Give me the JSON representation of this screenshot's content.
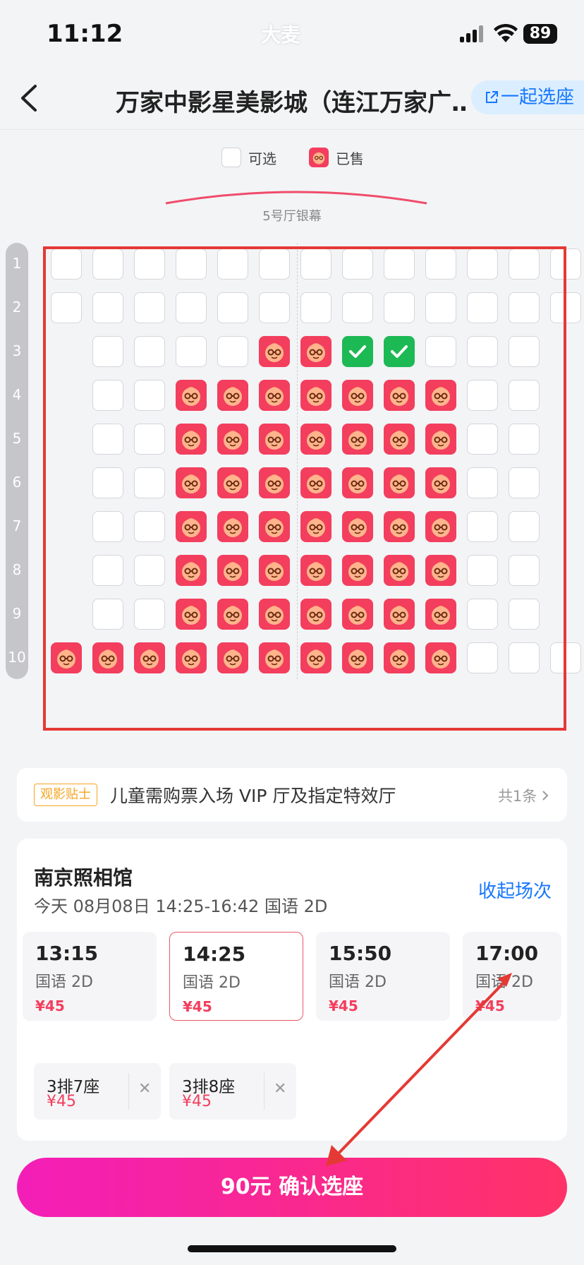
{
  "status_bar": {
    "time": "11:12",
    "brand": "大麦",
    "battery": "89"
  },
  "header": {
    "title": "万家中影星美影城（连江万家广…",
    "together_label": "一起选座"
  },
  "legend": {
    "available": "可选",
    "sold": "已售"
  },
  "screen": {
    "label": "5号厅银幕"
  },
  "seat_map": {
    "row_labels": [
      "1",
      "2",
      "3",
      "4",
      "5",
      "6",
      "7",
      "8",
      "9",
      "10"
    ],
    "rows": [
      "AAAAAAAAAAAAA",
      "AAAAAAAAAAAAA",
      "_AAAASSCCAAA_",
      "_AASSSSSSSAA_",
      "_AASSSSSSSAA_",
      "_AASSSSSSSAA_",
      "_AASSSSSSSAA_",
      "_AASSSSSSSAA_",
      "_AASSSSSSSAA_",
      "SSSSSSSSSSAAA"
    ]
  },
  "tip": {
    "badge": "观影贴士",
    "text": "儿童需购票入场 VIP 厅及指定特效厅",
    "count": "共1条"
  },
  "show": {
    "movie_title": "南京照相馆",
    "info": "今天 08月08日 14:25-16:42 国语 2D",
    "collapse_label": "收起场次",
    "times": [
      {
        "time": "13:15",
        "type": "国语 2D",
        "price": "¥45"
      },
      {
        "time": "14:25",
        "type": "国语 2D",
        "price": "¥45"
      },
      {
        "time": "15:50",
        "type": "国语 2D",
        "price": "¥45"
      },
      {
        "time": "17:00",
        "type": "国语 2D",
        "price": "¥45"
      }
    ]
  },
  "tickets": [
    {
      "seat": "3排7座",
      "price": "¥45"
    },
    {
      "seat": "3排8座",
      "price": "¥45"
    }
  ],
  "confirm": {
    "label": "90元 确认选座"
  },
  "colors": {
    "sold": "#f33e5e",
    "selected": "#1db954",
    "accent": "#1677ff",
    "highlight": "#e53935"
  }
}
